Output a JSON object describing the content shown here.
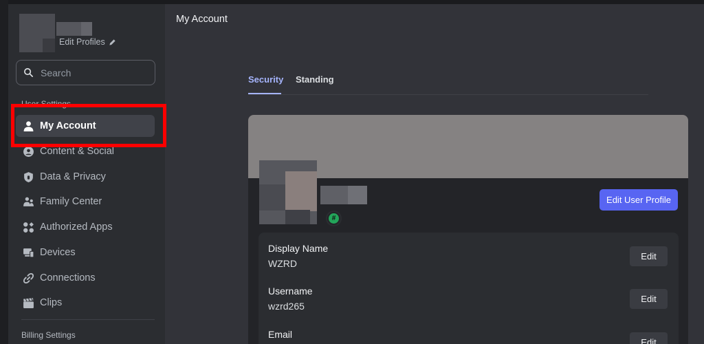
{
  "sidebar": {
    "edit_profiles_label": "Edit Profiles",
    "search_placeholder": "Search",
    "user_settings_header": "User Settings",
    "items": [
      {
        "label": "My Account",
        "icon": "person-icon",
        "active": true
      },
      {
        "label": "Content & Social",
        "icon": "content-social-icon"
      },
      {
        "label": "Data & Privacy",
        "icon": "shield-icon"
      },
      {
        "label": "Family Center",
        "icon": "family-icon"
      },
      {
        "label": "Authorized Apps",
        "icon": "apps-icon"
      },
      {
        "label": "Devices",
        "icon": "devices-icon"
      },
      {
        "label": "Connections",
        "icon": "link-icon"
      },
      {
        "label": "Clips",
        "icon": "clapperboard-icon"
      }
    ],
    "billing_settings_header": "Billing Settings"
  },
  "main": {
    "title": "My Account",
    "tabs": [
      {
        "label": "Security",
        "active": true
      },
      {
        "label": "Standing"
      }
    ],
    "edit_user_profile_label": "Edit User Profile",
    "fields": [
      {
        "label": "Display Name",
        "value": "WZRD",
        "button": "Edit"
      },
      {
        "label": "Username",
        "value": "wzrd265",
        "button": "Edit"
      },
      {
        "label": "Email",
        "value": "",
        "button": "Edit"
      }
    ]
  },
  "colors": {
    "accent": "#5865f2",
    "tab_active": "#a5b4fc",
    "banner": "#858282",
    "highlight": "#ff0000",
    "status_badge": "#23a55a"
  }
}
